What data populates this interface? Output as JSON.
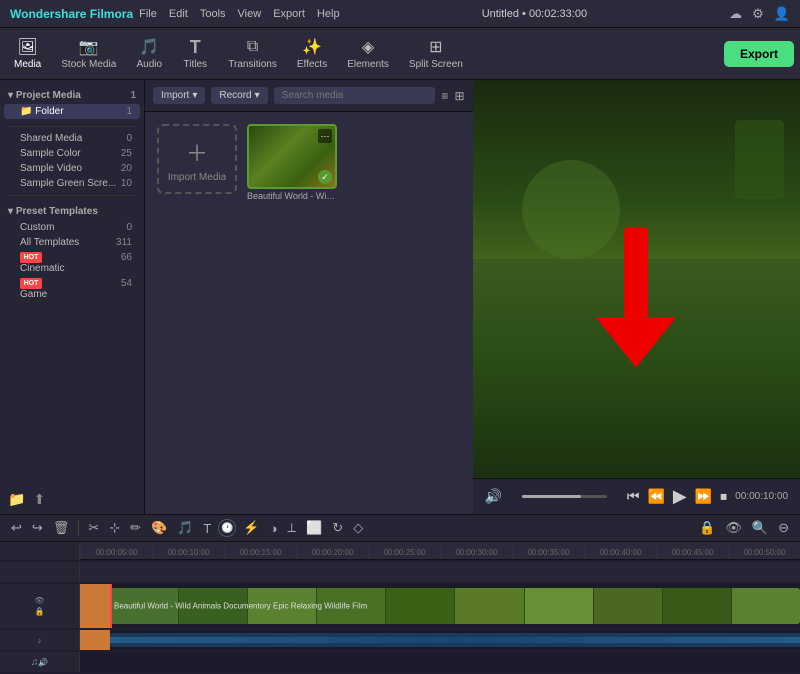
{
  "titleBar": {
    "appName": "Wondershare Filmora",
    "menus": [
      "File",
      "Edit",
      "Tools",
      "View",
      "Export",
      "Help"
    ],
    "title": "Untitled • 00:02:33:00",
    "icons": [
      "cloud-icon",
      "settings-icon",
      "user-icon"
    ]
  },
  "toolbar": {
    "items": [
      {
        "id": "media",
        "label": "Media",
        "icon": "🖼",
        "active": true
      },
      {
        "id": "stock-media",
        "label": "Stock Media",
        "icon": "📷",
        "active": false
      },
      {
        "id": "audio",
        "label": "Audio",
        "icon": "🎵",
        "active": false
      },
      {
        "id": "titles",
        "label": "Titles",
        "icon": "T",
        "active": false
      },
      {
        "id": "transitions",
        "label": "Transitions",
        "icon": "⧉",
        "active": false
      },
      {
        "id": "effects",
        "label": "Effects",
        "icon": "✨",
        "active": false
      },
      {
        "id": "elements",
        "label": "Elements",
        "icon": "◈",
        "active": false
      },
      {
        "id": "split-screen",
        "label": "Split Screen",
        "icon": "⊞",
        "active": false
      }
    ],
    "exportLabel": "Export"
  },
  "sidebar": {
    "projectMedia": {
      "label": "Project Media",
      "count": 1,
      "children": [
        {
          "label": "Folder",
          "count": 1,
          "active": true
        }
      ]
    },
    "sharedMedia": {
      "label": "Shared Media",
      "count": 0
    },
    "sampleColor": {
      "label": "Sample Color",
      "count": 25
    },
    "sampleVideo": {
      "label": "Sample Video",
      "count": 20
    },
    "sampleGreenScreen": {
      "label": "Sample Green Scre...",
      "count": 10
    },
    "presetTemplates": {
      "label": "Preset Templates",
      "children": [
        {
          "label": "Custom",
          "count": 0
        },
        {
          "label": "All Templates",
          "count": 311
        },
        {
          "label": "Cinematic",
          "count": 66,
          "badge": "HOT"
        },
        {
          "label": "Game",
          "count": 54,
          "badge": "HOT"
        }
      ]
    }
  },
  "mediaPanel": {
    "importLabel": "Import",
    "recordLabel": "Record",
    "searchPlaceholder": "Search media",
    "importMediaLabel": "Import Media",
    "items": [
      {
        "name": "Beautiful World - Wild A...",
        "hasCheck": true
      }
    ]
  },
  "preview": {
    "timeDisplay": "00:00:10:00",
    "duration": "00:02:33:00",
    "progressPercent": 0
  },
  "timeline": {
    "buttons": [
      "undo",
      "redo",
      "delete",
      "cut",
      "transform",
      "stabilize",
      "speed",
      "color",
      "audio",
      "text",
      "keyframe",
      "mask",
      "freeze",
      "split",
      "crop",
      "rotate",
      "flip"
    ],
    "rulerMarks": [
      "00:00:05:00",
      "00:00:10:00",
      "00:00:15:00",
      "00:00:20:00",
      "00:00:25:00",
      "00:00:30:00",
      "00:00:35:00",
      "00:00:40:00",
      "00:00:45:00",
      "00:00:50:00"
    ],
    "tracks": [
      {
        "type": "main-video",
        "label": "",
        "content": "Beautiful World - Wild Animals Documentory Epic Relaxing Wildlife Film"
      }
    ]
  }
}
